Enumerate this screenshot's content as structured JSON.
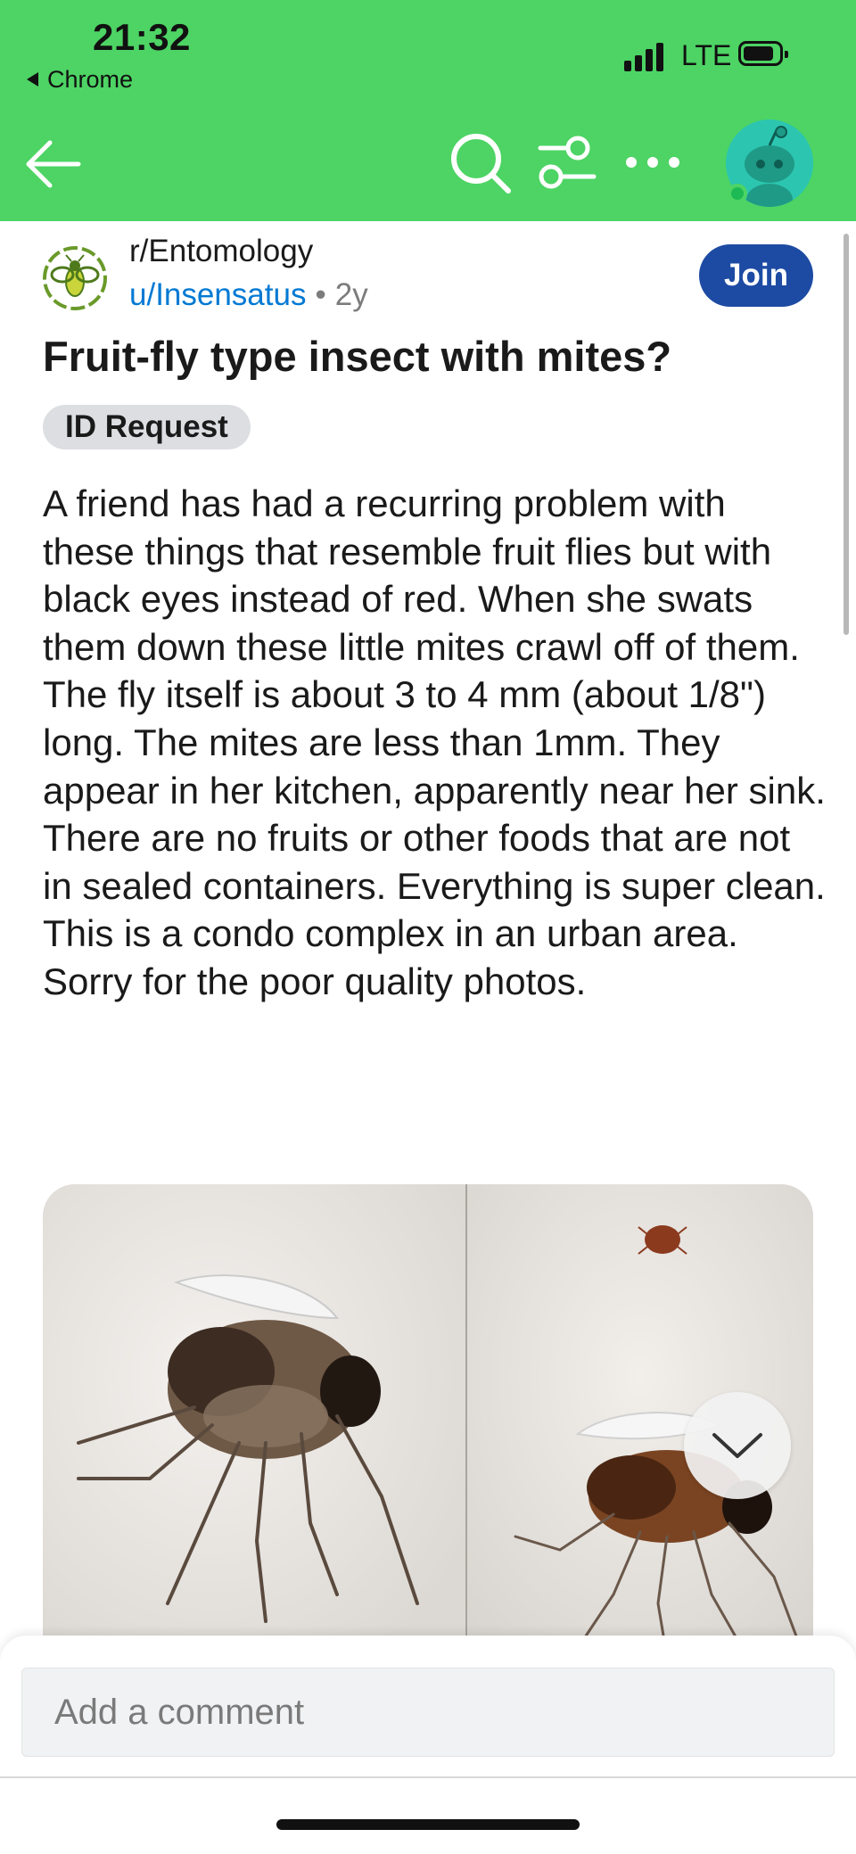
{
  "status_bar": {
    "time": "21:32",
    "back_app": "Chrome",
    "network": "LTE"
  },
  "nav": {
    "back_icon": "arrow-left-icon",
    "search_icon": "search-icon",
    "filter_icon": "sort-filter-icon",
    "more_icon": "more-horizontal-icon",
    "avatar_icon": "snoo-avatar-icon"
  },
  "post": {
    "subreddit": "r/Entomology",
    "author": "u/Insensatus",
    "separator": "•",
    "age": "2y",
    "join_label": "Join",
    "title": "Fruit-fly type insect with mites?",
    "flair": "ID Request",
    "body": "A friend has had a recurring problem with these things that resemble fruit flies but with black eyes instead of red. When she swats them down these little mites crawl off of them. The fly itself is about 3 to 4 mm (about 1/8\") long. The mites are less than 1mm. They appear in her kitchen, apparently near her sink. There are no fruits or other foods that are not in sealed containers. Everything is super clean. This is a condo complex in an urban area. Sorry for the poor quality photos.",
    "media_collapse_icon": "chevron-down-icon"
  },
  "comment_box": {
    "placeholder": "Add a comment"
  },
  "colors": {
    "topbar": "#4dd464",
    "join_button": "#1d4ba3",
    "username": "#0079d3",
    "flair_bg": "#dcdee1"
  }
}
